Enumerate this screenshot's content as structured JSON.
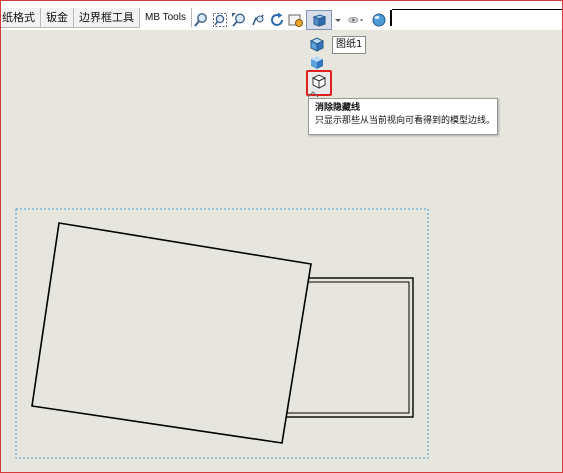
{
  "tabs": [
    {
      "label": "纸格式",
      "active": false
    },
    {
      "label": "钣金",
      "active": false
    },
    {
      "label": "边界框工具",
      "active": false
    },
    {
      "label": "MB Tools",
      "active": true
    }
  ],
  "view_toolbar": {
    "icons": [
      "zoom-to-fit-icon",
      "zoom-to-area-icon",
      "zoom-in-out-icon",
      "pan-icon",
      "rotate-icon",
      "view-settings-icon",
      "display-style-icon",
      "hide-show-items-icon",
      "appearance-icon"
    ]
  },
  "display_style_dropdown": {
    "first_item_tooltip": "图纸1",
    "highlighted_item": {
      "title": "消除隐藏线",
      "description": "只显示那些从当前视向可看得到的模型边线。"
    }
  },
  "colors": {
    "background": "#e7e6de",
    "highlight_border": "#e02020",
    "frame_border": "#d23b3b",
    "selection_box": "#4a9bd8"
  }
}
